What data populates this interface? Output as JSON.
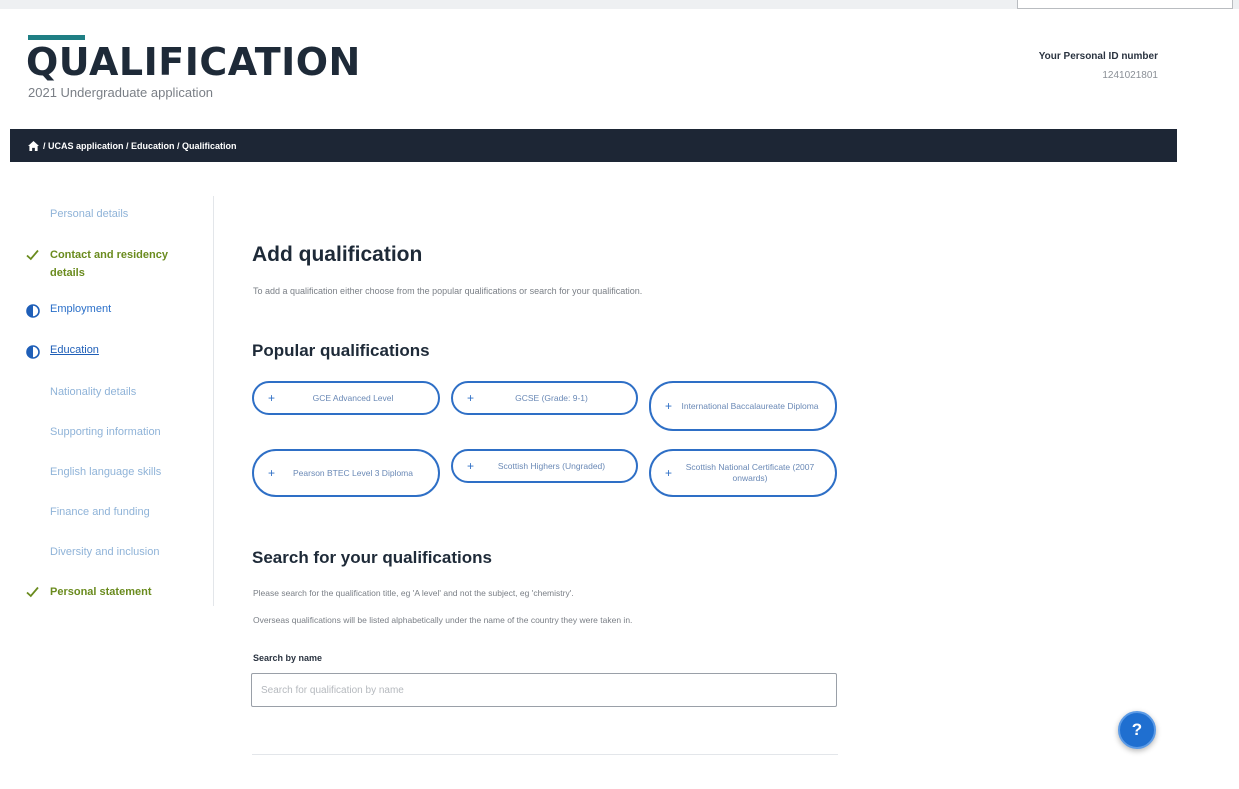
{
  "header": {
    "title": "QUALIFICATION",
    "subtitle": "2021 Undergraduate application",
    "personal_id_label": "Your Personal ID number",
    "personal_id_value": "1241021801"
  },
  "breadcrumb": {
    "text": "/ UCAS application / Education / Qualification"
  },
  "sidebar": {
    "items": [
      {
        "label": "Personal details",
        "status": "none"
      },
      {
        "label": "Contact and residency details",
        "line1": "Contact and residency",
        "line2": "details",
        "status": "complete"
      },
      {
        "label": "Employment",
        "status": "in-progress"
      },
      {
        "label": "Education",
        "status": "in-progress-current"
      },
      {
        "label": "Nationality details",
        "status": "none"
      },
      {
        "label": "Supporting information",
        "status": "none"
      },
      {
        "label": "English language skills",
        "status": "none"
      },
      {
        "label": "Finance and funding",
        "status": "none"
      },
      {
        "label": "Diversity and inclusion",
        "status": "none"
      },
      {
        "label": "Personal statement",
        "status": "complete"
      }
    ]
  },
  "main": {
    "heading": "Add qualification",
    "intro": "To add a qualification either choose from the popular qualifications or search for your qualification.",
    "popular_heading": "Popular qualifications",
    "popular": [
      {
        "label": "GCE Advanced Level"
      },
      {
        "label": "GCSE (Grade: 9-1)"
      },
      {
        "label": "International Baccalaureate Diploma"
      },
      {
        "label": "Pearson BTEC Level 3 Diploma"
      },
      {
        "label": "Scottish Highers (Ungraded)"
      },
      {
        "label": "Scottish National Certificate (2007 onwards)"
      }
    ],
    "search_heading": "Search for your qualifications",
    "search_help_1": "Please search for the qualification title, eg 'A level' and not the subject, eg 'chemistry'.",
    "search_help_2": "Overseas qualifications will be listed alphabetically under the name of the country they were taken in.",
    "search_label": "Search by name",
    "search_placeholder": "Search for qualification by name",
    "search_value": ""
  },
  "help": {
    "label": "?"
  },
  "colors": {
    "navbar": "#1d2635",
    "accent": "#1f7f84",
    "complete": "#6a8b1e",
    "link": "#2e6fc6"
  }
}
